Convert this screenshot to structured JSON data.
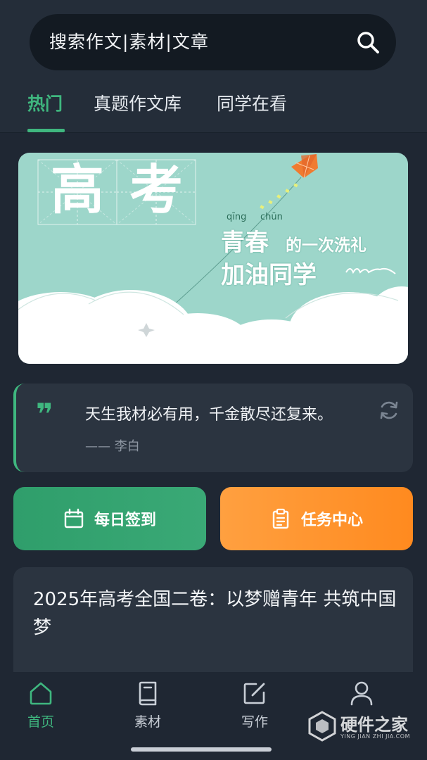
{
  "search": {
    "text": "搜索作文|素材|文章",
    "icon": "search-icon"
  },
  "tabs": [
    {
      "label": "热门",
      "active": true
    },
    {
      "label": "真题作文库",
      "active": false
    },
    {
      "label": "同学在看",
      "active": false
    }
  ],
  "banner": {
    "title_chars": [
      "高",
      "考"
    ],
    "pinyin_1": "qīng",
    "pinyin_2": "chūn",
    "slogan_big": "青春",
    "slogan_small": "的一次洗礼",
    "slogan_2": "加油同学"
  },
  "quote": {
    "mark": "❞",
    "text": "天生我材必有用，千金散尽还复来。",
    "author": "—— 李白",
    "icon": "refresh-icon"
  },
  "actions": {
    "checkin_label": "每日签到",
    "checkin_icon": "calendar-icon",
    "tasks_label": "任务中心",
    "tasks_icon": "clipboard-icon"
  },
  "article": {
    "title": "2025年高考全国二卷：以梦赠青年 共筑中国梦"
  },
  "nav": [
    {
      "label": "首页",
      "icon": "home-icon",
      "active": true
    },
    {
      "label": "素材",
      "icon": "book-icon",
      "active": false
    },
    {
      "label": "写作",
      "icon": "edit-icon",
      "active": false
    },
    {
      "label": "",
      "icon": "user-icon",
      "active": false
    }
  ],
  "watermark": {
    "text": "硬件之家",
    "sub": "YING JIAN ZHI JIA.COM"
  },
  "colors": {
    "accent": "#3fb77f",
    "orange": "#ff8a1f",
    "background": "#1f2733",
    "card": "#2b3440"
  }
}
